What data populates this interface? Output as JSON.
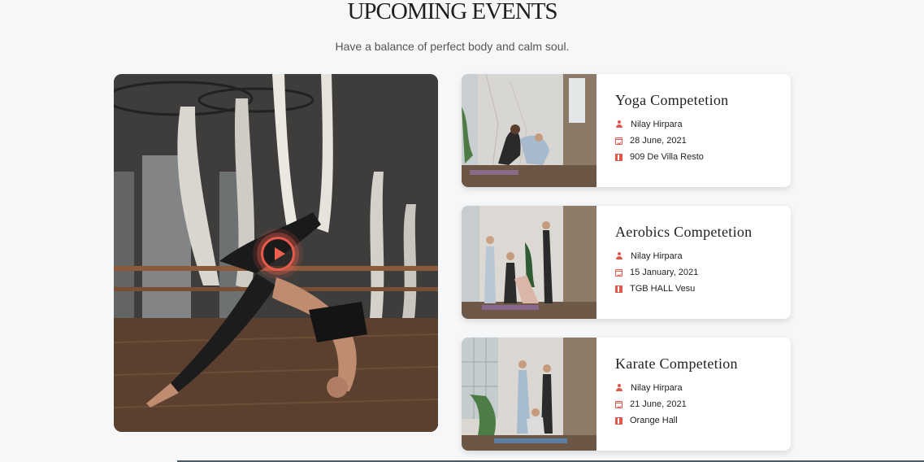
{
  "header": {
    "title": "UPCOMING EVENTS",
    "subtitle": "Have a balance of perfect body and calm soul."
  },
  "video": {
    "play_icon": "play-icon",
    "accent": "#e85b4c"
  },
  "events": [
    {
      "title": "Yoga Competetion",
      "organizer": "Nilay Hirpara",
      "date": "28 June, 2021",
      "location": "909 De Villa Resto"
    },
    {
      "title": "Aerobics Competetion",
      "organizer": "Nilay Hirpara",
      "date": "15 January, 2021",
      "location": "TGB HALL Vesu"
    },
    {
      "title": "Karate Competetion",
      "organizer": "Nilay Hirpara",
      "date": "21 June, 2021",
      "location": "Orange Hall"
    }
  ],
  "icons": {
    "organizer": "user-icon",
    "date": "calendar-icon",
    "location": "map-icon"
  },
  "colors": {
    "accent": "#e0584b",
    "background": "#f6f7f9"
  }
}
